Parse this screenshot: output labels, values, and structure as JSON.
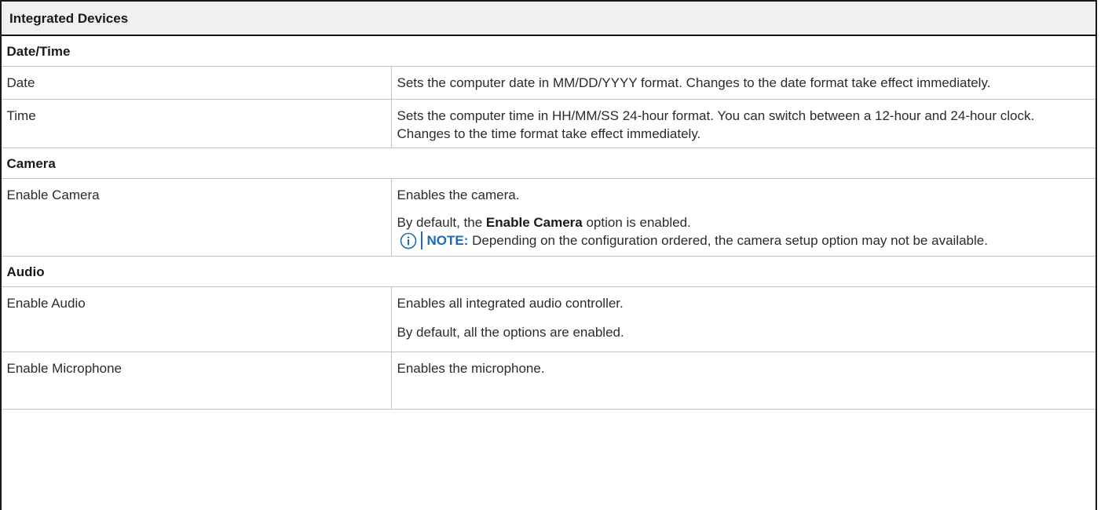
{
  "table": {
    "header": "Integrated Devices",
    "sections": {
      "datetime": "Date/Time",
      "camera": "Camera",
      "audio": "Audio"
    },
    "rows": {
      "date": {
        "label": "Date",
        "desc": "Sets the computer date in MM/DD/YYYY format. Changes to the date format take effect immediately."
      },
      "time": {
        "label": "Time",
        "desc": "Sets the computer time in HH/MM/SS 24-hour format. You can switch between a 12-hour and 24-hour clock. Changes to the time format take effect immediately."
      },
      "enable_camera": {
        "label": "Enable Camera",
        "desc1": "Enables the camera.",
        "desc2_pre": "By default, the ",
        "desc2_bold": "Enable Camera",
        "desc2_post": " option is enabled.",
        "note_keyword": "NOTE:",
        "note_text": " Depending on the configuration ordered, the camera setup option may not be available.",
        "note_icon": "info-icon"
      },
      "enable_audio": {
        "label": "Enable Audio",
        "desc1": "Enables all integrated audio controller.",
        "desc2": "By default, all the options are enabled."
      },
      "enable_microphone": {
        "label": "Enable Microphone",
        "desc1": "Enables the microphone."
      }
    }
  },
  "colors": {
    "note_accent": "#1b6bb5",
    "border": "#c4c4c4",
    "header_bg": "#f0f0f0"
  }
}
